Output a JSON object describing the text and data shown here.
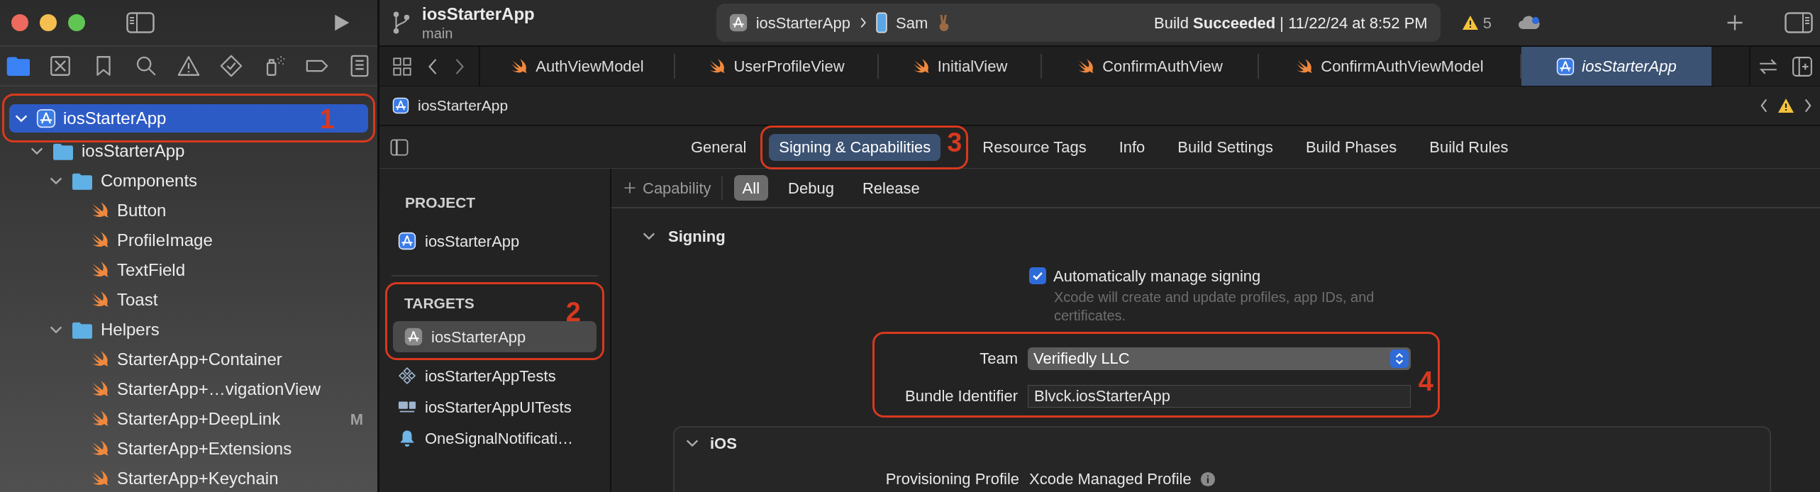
{
  "toolbar": {
    "project": "iosStarterApp",
    "branch": "main",
    "scheme": "iosStarterApp",
    "device": "Sam",
    "status": "Build **Succeeded** | 11/22/24 at 8:52 PM",
    "warning_count": "5"
  },
  "navigator": {
    "tabs": [
      {
        "kind": "project",
        "selected": true
      },
      {
        "kind": "source",
        "selected": false
      },
      {
        "kind": "bookmark",
        "selected": false
      },
      {
        "kind": "search",
        "selected": false
      },
      {
        "kind": "issue",
        "selected": false
      },
      {
        "kind": "test",
        "selected": false
      },
      {
        "kind": "debug",
        "selected": false
      },
      {
        "kind": "breakpoint",
        "selected": false
      },
      {
        "kind": "report",
        "selected": false
      }
    ],
    "tree": [
      {
        "label": "iosStarterApp",
        "kind": "project",
        "expanded": true,
        "selected": true,
        "annotation": "1",
        "children": [
          {
            "label": "iosStarterApp",
            "kind": "folder",
            "expanded": true,
            "selected": false,
            "children": [
              {
                "label": "Components",
                "kind": "folder",
                "expanded": true,
                "selected": false,
                "children": [
                  {
                    "label": "Button",
                    "kind": "swift",
                    "selected": false
                  },
                  {
                    "label": "ProfileImage",
                    "kind": "swift",
                    "selected": false
                  },
                  {
                    "label": "TextField",
                    "kind": "swift",
                    "selected": false
                  },
                  {
                    "label": "Toast",
                    "kind": "swift",
                    "selected": false
                  }
                ]
              },
              {
                "label": "Helpers",
                "kind": "folder",
                "expanded": true,
                "selected": false,
                "children": [
                  {
                    "label": "StarterApp+Container",
                    "kind": "swift",
                    "selected": false
                  },
                  {
                    "label": "StarterApp+…vigationView",
                    "kind": "swift",
                    "selected": false
                  },
                  {
                    "label": "StarterApp+DeepLink",
                    "kind": "swift",
                    "selected": false,
                    "badge": "M"
                  },
                  {
                    "label": "StarterApp+Extensions",
                    "kind": "swift",
                    "selected": false
                  },
                  {
                    "label": "StarterApp+Keychain",
                    "kind": "swift",
                    "selected": false
                  }
                ]
              }
            ]
          }
        ]
      }
    ]
  },
  "editor_tabs": [
    {
      "label": "AuthViewModel",
      "kind": "swift",
      "selected": false
    },
    {
      "label": "UserProfileView",
      "kind": "swift",
      "selected": false
    },
    {
      "label": "InitialView",
      "kind": "swift",
      "selected": false
    },
    {
      "label": "ConfirmAuthView",
      "kind": "swift",
      "selected": false
    },
    {
      "label": "ConfirmAuthViewModel",
      "kind": "swift",
      "selected": false
    },
    {
      "label": "iosStarterApp",
      "kind": "project",
      "selected": true
    }
  ],
  "breadcrumb": "iosStarterApp",
  "settings_tabs": [
    {
      "label": "General",
      "selected": false
    },
    {
      "label": "Signing & Capabilities",
      "selected": true,
      "annotation": "3"
    },
    {
      "label": "Resource Tags",
      "selected": false
    },
    {
      "label": "Info",
      "selected": false
    },
    {
      "label": "Build Settings",
      "selected": false
    },
    {
      "label": "Build Phases",
      "selected": false
    },
    {
      "label": "Build Rules",
      "selected": false
    }
  ],
  "project_list": {
    "project_heading": "PROJECT",
    "projects": [
      {
        "label": "iosStarterApp",
        "kind": "project",
        "selected": false
      }
    ],
    "targets_heading": "TARGETS",
    "targets_annotation": "2",
    "targets": [
      {
        "label": "iosStarterApp",
        "kind": "app",
        "selected": true
      },
      {
        "label": "iosStarterAppTests",
        "kind": "tests",
        "selected": false
      },
      {
        "label": "iosStarterAppUITests",
        "kind": "uitests",
        "selected": false
      },
      {
        "label": "OneSignalNotificati…",
        "kind": "extension",
        "selected": false
      }
    ]
  },
  "capability_bar": {
    "add_label": "Capability",
    "filters": [
      {
        "label": "All",
        "selected": true
      },
      {
        "label": "Debug",
        "selected": false
      },
      {
        "label": "Release",
        "selected": false
      }
    ]
  },
  "signing": {
    "title": "Signing",
    "expanded": true,
    "auto_manage": {
      "label": "Automatically manage signing",
      "checked": true,
      "hint": "Xcode will create and update profiles, app IDs, and certificates."
    },
    "annotation": "4",
    "team": {
      "label": "Team",
      "value": "Verifiedly LLC"
    },
    "bundle_identifier": {
      "label": "Bundle Identifier",
      "value": "Blvck.iosStarterApp"
    }
  },
  "ios": {
    "title": "iOS",
    "expanded": true,
    "provisioning_profile": {
      "label": "Provisioning Profile",
      "value": "Xcode Managed Profile"
    }
  }
}
